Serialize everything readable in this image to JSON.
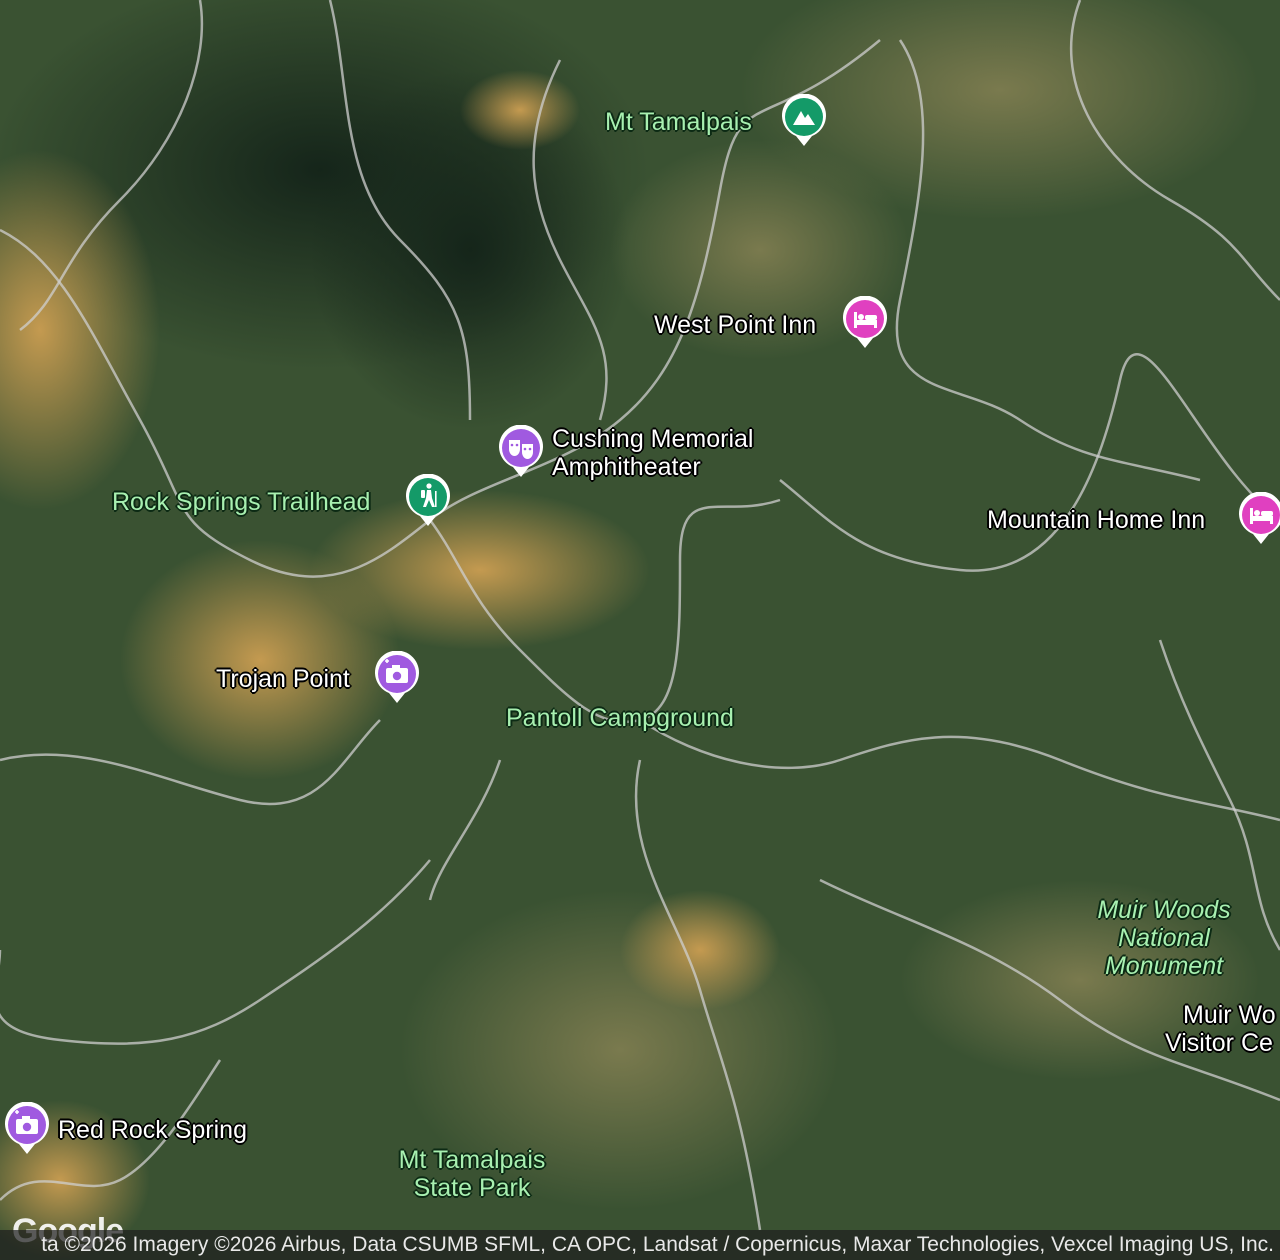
{
  "map": {
    "colors": {
      "forest": "#2f4a2c",
      "forest_dark": "#1c2f1d",
      "grass": "#b8914a",
      "trail": "#c9c9c9",
      "lodging": "#e040c0",
      "attraction": "#a05ae0",
      "hiking": "#149a68",
      "peak": "#149a68"
    },
    "places": [
      {
        "name": "Mt Tamalpais",
        "icon": "mountain-icon"
      },
      {
        "name": "West Point Inn",
        "icon": "hotel-bed-icon"
      },
      {
        "name_line1": "Cushing Memorial",
        "name_line2": "Amphitheater",
        "icon": "theater-masks-icon"
      },
      {
        "name": "Rock Springs Trailhead",
        "icon": "hiker-icon"
      },
      {
        "name": "Mountain Home Inn",
        "icon": "hotel-bed-icon"
      },
      {
        "name": "Trojan Point",
        "icon": "camera-icon"
      },
      {
        "name": "Pantoll Campground"
      },
      {
        "name_line1": "Muir Woods",
        "name_line2": "National",
        "name_line3": "Monument"
      },
      {
        "name_line1": "Muir Wo",
        "name_line2": "Visitor Ce"
      },
      {
        "name": "Red Rock Spring",
        "icon": "camera-icon"
      },
      {
        "name_line1": "Mt Tamalpais",
        "name_line2": "State Park"
      }
    ],
    "logo": "Google",
    "attribution": "ta ©2026 Imagery ©2026 Airbus, Data CSUMB SFML, CA OPC, Landsat / Copernicus, Maxar Technologies, Vexcel Imaging US, Inc."
  }
}
